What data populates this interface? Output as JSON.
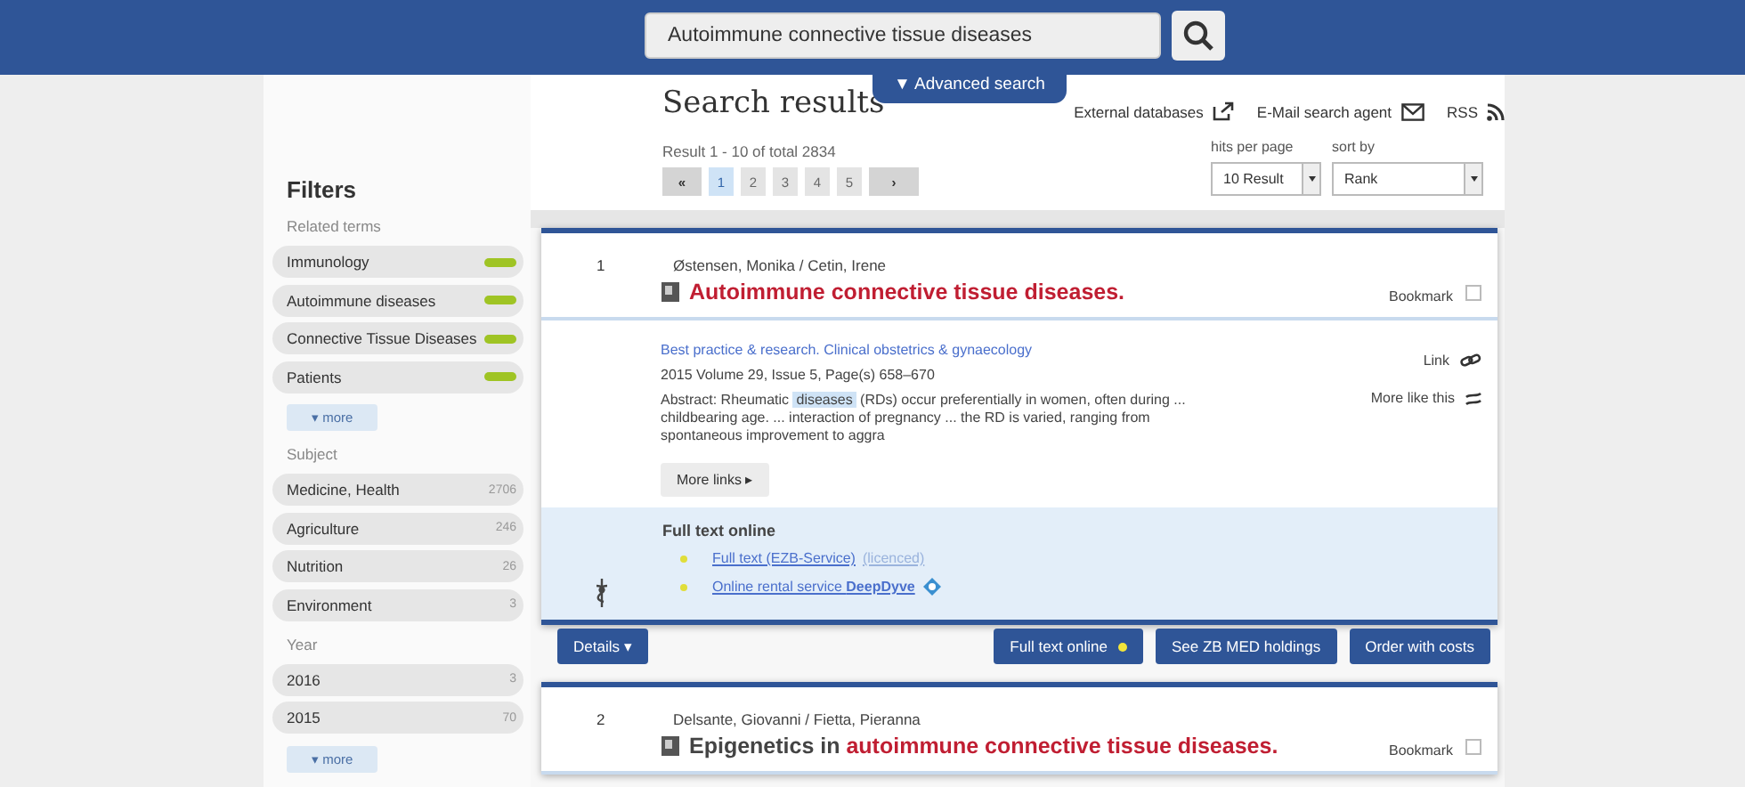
{
  "search": {
    "value": "Autoimmune connective tissue diseases",
    "advanced": "▼ Advanced search"
  },
  "sidebar": {
    "title": "Filters",
    "groups": [
      {
        "heading": "Related terms",
        "kind": "terms",
        "items": [
          {
            "label": "Immunology"
          },
          {
            "label": "Autoimmune diseases"
          },
          {
            "label": "Connective Tissue Diseases"
          },
          {
            "label": "Patients"
          }
        ],
        "more": "▾ more"
      },
      {
        "heading": "Subject",
        "kind": "counts",
        "items": [
          {
            "label": "Medicine, Health",
            "count": "2706"
          },
          {
            "label": "Agriculture",
            "count": "246"
          },
          {
            "label": "Nutrition",
            "count": "26"
          },
          {
            "label": "Environment",
            "count": "3"
          }
        ]
      },
      {
        "heading": "Year",
        "kind": "counts",
        "items": [
          {
            "label": "2016",
            "count": "3"
          },
          {
            "label": "2015",
            "count": "70"
          }
        ],
        "more": "▾ more"
      }
    ]
  },
  "results_header": {
    "title": "Search results",
    "links": [
      {
        "label": "External databases",
        "kind": "external"
      },
      {
        "label": "E-Mail search agent",
        "kind": "mail"
      },
      {
        "label": "RSS",
        "kind": "rss"
      }
    ],
    "summary": "Result 1 - 10 of total 2834",
    "pages": [
      {
        "label": "1",
        "selected": true
      },
      {
        "label": "2",
        "selected": false
      },
      {
        "label": "3",
        "selected": false
      },
      {
        "label": "4",
        "selected": false
      },
      {
        "label": "5",
        "selected": false
      }
    ],
    "first": "«",
    "next": "›",
    "hits_label": "hits per page",
    "hits_value": "10 Result",
    "sort_label": "sort by",
    "sort_value": "Rank"
  },
  "results": [
    {
      "number": "1",
      "authors": "Østensen, Monika / Cetin, Irene",
      "title": [
        {
          "text": "Autoimmune connective tissue diseases.",
          "highlight": true
        }
      ],
      "bookmark": "Bookmark",
      "bookmarked": false,
      "journal": "Best practice & research. Clinical obstetrics & gynaecology",
      "citation": "2015  Volume 29, Issue 5, Page(s) 658–670",
      "abstract": [
        {
          "text": "Abstract: Rheumatic ",
          "highlight": false
        },
        {
          "text": "diseases",
          "highlight": true
        },
        {
          "text": " (RDs) occur preferentially in women, often during ... childbearing age. ... interaction of pregnancy ... the RD is varied, ranging from spontaneous improvement to aggra",
          "highlight": false
        }
      ],
      "side_links": [
        {
          "label": "Link",
          "kind": "link"
        },
        {
          "label": "More like this",
          "kind": "similar"
        }
      ],
      "more_links": "More links ▸",
      "fulltext": {
        "heading": "Full text online",
        "items": [
          {
            "link": "Full text (EZB-Service)",
            "note": "(licenced)"
          },
          {
            "link": "Online rental service **DeepDyve**",
            "badge": true
          }
        ]
      },
      "buttons": [
        {
          "label": "Full text online",
          "dot": true
        },
        {
          "label": "See ZB MED holdings",
          "dot": false
        },
        {
          "label": "Order with costs",
          "dot": false
        }
      ],
      "details": "Details ▾"
    },
    {
      "number": "2",
      "authors": "Delsante, Giovanni / Fietta, Pieranna",
      "title": [
        {
          "text": "Epigenetics in ",
          "highlight": false
        },
        {
          "text": "autoimmune connective tissue diseases.",
          "highlight": true
        }
      ],
      "bookmark": "Bookmark",
      "bookmarked": false
    }
  ]
}
